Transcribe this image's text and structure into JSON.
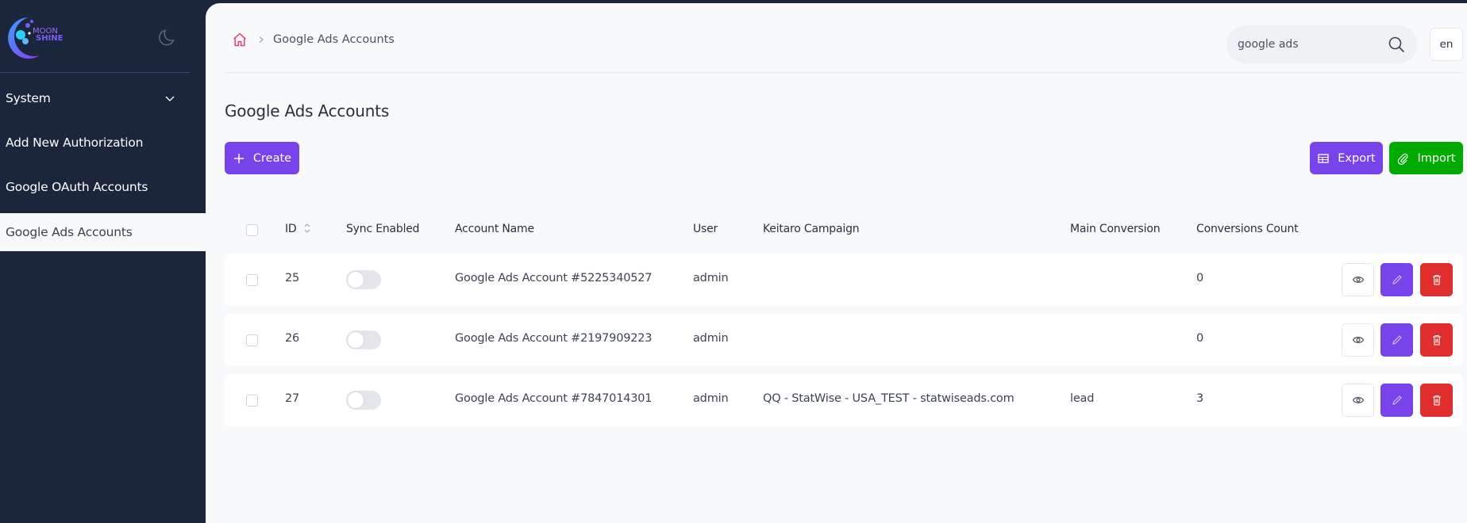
{
  "sidebar": {
    "logo_text_top": "MOON",
    "logo_text_bottom": "SHINE",
    "theme_toggle_icon": "moon-icon",
    "items": [
      {
        "label": "System",
        "icon": "chevron-down-icon",
        "expandable": true
      },
      {
        "label": "Add New Authorization"
      },
      {
        "label": "Google OAuth Accounts"
      },
      {
        "label": "Google Ads Accounts",
        "active": true
      }
    ]
  },
  "header": {
    "breadcrumb": {
      "home_icon": "home-icon",
      "separator_icon": "chevron-right-icon",
      "current": "Google Ads Accounts"
    },
    "search": {
      "value": "google ads",
      "placeholder": "Search",
      "icon": "search-icon"
    },
    "language": "en"
  },
  "page": {
    "title": "Google Ads Accounts",
    "buttons": {
      "create": "Create",
      "export": "Export",
      "import": "Import"
    }
  },
  "colors": {
    "accent": "#7843e9",
    "success": "#00aa00",
    "danger": "#e02d2d",
    "sidebar_bg": "#1b253b",
    "content_bg": "#f8f9fb",
    "home_icon": "#e8406a"
  },
  "table": {
    "columns": [
      "ID",
      "Sync Enabled",
      "Account Name",
      "User",
      "Keitaro Campaign",
      "Main Conversion",
      "Conversions Count"
    ],
    "rows": [
      {
        "id": "25",
        "sync_enabled": false,
        "account_name": "Google Ads Account #5225340527",
        "user": "admin",
        "keitaro_campaign": "",
        "main_conversion": "",
        "conversions_count": "0"
      },
      {
        "id": "26",
        "sync_enabled": false,
        "account_name": "Google Ads Account #2197909223",
        "user": "admin",
        "keitaro_campaign": "",
        "main_conversion": "",
        "conversions_count": "0"
      },
      {
        "id": "27",
        "sync_enabled": false,
        "account_name": "Google Ads Account #7847014301",
        "user": "admin",
        "keitaro_campaign": "QQ - StatWise - USA_TEST - statwiseads.com",
        "main_conversion": "lead",
        "conversions_count": "3"
      }
    ],
    "row_actions": [
      "view",
      "edit",
      "delete"
    ]
  }
}
